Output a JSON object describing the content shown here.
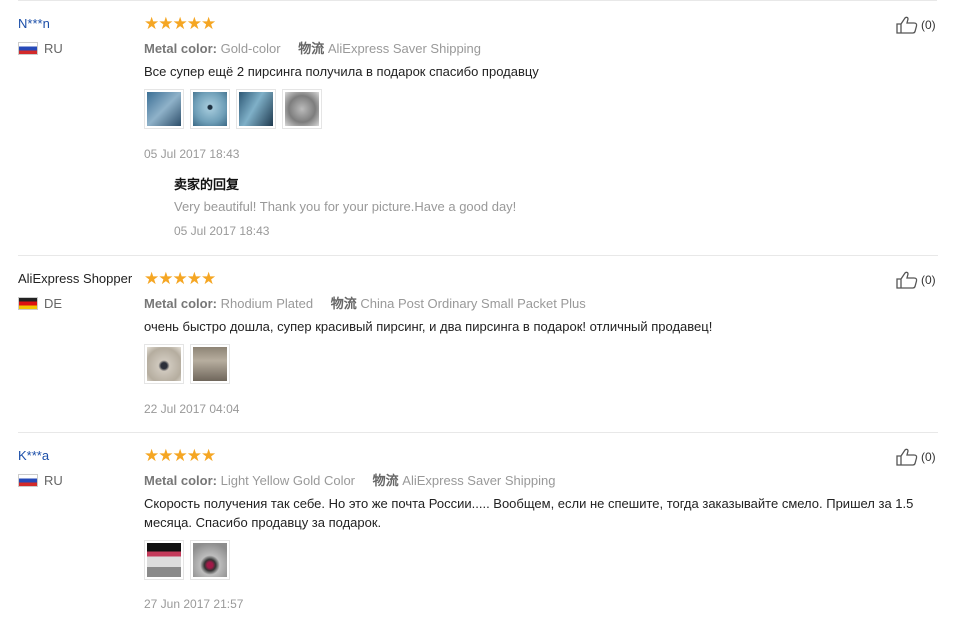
{
  "reviews": [
    {
      "user": "N***n",
      "country": "RU",
      "stars": "★★★★★",
      "attr_label": "Metal color:",
      "attr_value": "Gold-color",
      "ship_label": "物流",
      "ship_value": "AliExpress Saver Shipping",
      "text": "Все супер ещё 2 пирсинга получила в подарок спасибо продавцу",
      "date": "05 Jul 2017 18:43",
      "likes": "(0)",
      "reply": {
        "title": "卖家的回复",
        "text": "Very beautiful! Thank you for your picture.Have a good day!",
        "date": "05 Jul 2017 18:43"
      }
    },
    {
      "user": "AliExpress Shopper",
      "country": "DE",
      "stars": "★★★★★",
      "attr_label": "Metal color:",
      "attr_value": "Rhodium Plated",
      "ship_label": "物流",
      "ship_value": "China Post Ordinary Small Packet Plus",
      "text": "очень быстро дошла, супер красивый пирсинг, и два пирсинга в подарок! отличный продавец!",
      "date": "22 Jul 2017 04:04",
      "likes": "(0)"
    },
    {
      "user": "K***a",
      "country": "RU",
      "stars": "★★★★★",
      "attr_label": "Metal color:",
      "attr_value": "Light Yellow Gold Color",
      "ship_label": "物流",
      "ship_value": "AliExpress Saver Shipping",
      "text": "Скорость получения так себе. Но это же почта России..... Вообщем, если не спешите, тогда заказывайте смело. Пришел за 1.5 месяца. Спасибо продавцу за подарок.",
      "date": "27 Jun 2017 21:57",
      "likes": "(0)"
    }
  ],
  "colors": {
    "star": "#f5a623",
    "link": "#1b4ea8",
    "muted": "#999999"
  }
}
